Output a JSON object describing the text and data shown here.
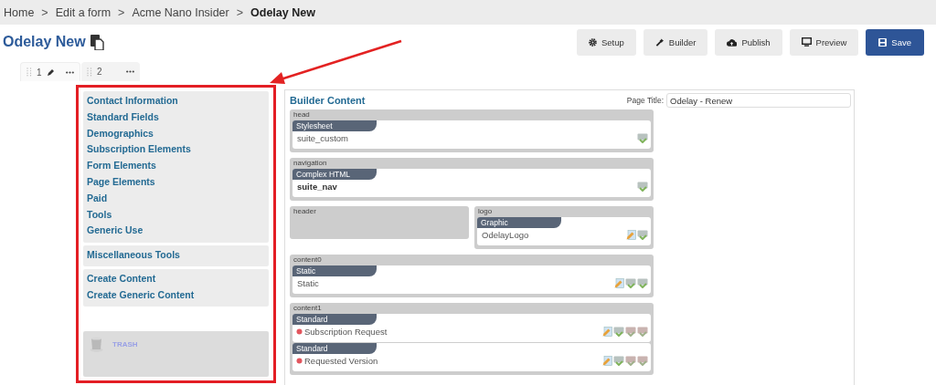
{
  "breadcrumb": [
    {
      "label": "Home",
      "separator": ">",
      "current": false
    },
    {
      "label": "Edit a form",
      "separator": ">",
      "current": false
    },
    {
      "label": "Acme Nano Insider",
      "separator": ">",
      "current": false
    },
    {
      "label": "Odelay New",
      "current": true
    }
  ],
  "page_title": "Odelay New",
  "toolbar": [
    {
      "label": "Setup",
      "kind": "setup",
      "primary": false
    },
    {
      "label": "Builder",
      "kind": "builder",
      "primary": false
    },
    {
      "label": "Publish",
      "kind": "publish",
      "primary": false
    },
    {
      "label": "Preview",
      "kind": "preview",
      "primary": false
    },
    {
      "label": "Save",
      "kind": "save",
      "primary": true
    }
  ],
  "tabs": [
    {
      "label": "1",
      "selected": true,
      "editable": true
    },
    {
      "label": "2",
      "selected": false,
      "editable": false
    }
  ],
  "sidebar": {
    "groups": [
      {
        "items": [
          "Contact Information",
          "Standard Fields",
          "Demographics",
          "Subscription Elements",
          "Form Elements",
          "Page Elements",
          "Paid",
          "Tools",
          "Generic Use"
        ]
      },
      {
        "items": [
          "Miscellaneous Tools"
        ]
      },
      {
        "items": [
          "Create Content",
          "Create Generic Content"
        ]
      }
    ],
    "trash": "TRASH"
  },
  "builder": {
    "title": "Builder Content",
    "page_title_label": "Page Title:",
    "page_title_value": "Odelay - Renew",
    "rows": [
      {
        "sections": [
          {
            "name": "head",
            "modules": [
              {
                "type": "Stylesheet",
                "name": "suite_custom",
                "emphasized": false,
                "required": false,
                "actions": [
                  {
                    "kind": "check"
                  }
                ]
              }
            ]
          }
        ]
      },
      {
        "sections": [
          {
            "name": "navigation",
            "modules": [
              {
                "type": "Complex HTML",
                "name": "suite_nav",
                "emphasized": true,
                "required": false,
                "actions": [
                  {
                    "kind": "check"
                  }
                ]
              }
            ]
          }
        ]
      },
      {
        "sections": [
          {
            "name": "header"
          },
          {
            "name": "logo",
            "modules": [
              {
                "type": "Graphic",
                "name": "OdelayLogo",
                "emphasized": false,
                "required": false,
                "actions": [
                  {
                    "kind": "edit"
                  },
                  {
                    "kind": "check"
                  }
                ]
              }
            ]
          }
        ]
      },
      {
        "sections": [
          {
            "name": "content0",
            "modules": [
              {
                "type": "Static",
                "name": "Static",
                "emphasized": false,
                "required": false,
                "actions": [
                  {
                    "kind": "edit"
                  },
                  {
                    "kind": "check"
                  },
                  {
                    "kind": "check"
                  }
                ]
              }
            ]
          }
        ]
      },
      {
        "sections": [
          {
            "name": "content1",
            "modules": [
              {
                "type": "Standard",
                "name": "Subscription Request",
                "emphasized": false,
                "required": true,
                "actions": [
                  {
                    "kind": "edit"
                  },
                  {
                    "kind": "check"
                  },
                  {
                    "kind": "deny"
                  },
                  {
                    "kind": "deny"
                  }
                ]
              },
              {
                "type": "Standard",
                "name": "Requested Version",
                "emphasized": false,
                "required": true,
                "actions": [
                  {
                    "kind": "edit"
                  },
                  {
                    "kind": "check"
                  },
                  {
                    "kind": "deny"
                  },
                  {
                    "kind": "deny"
                  }
                ]
              }
            ]
          }
        ]
      }
    ]
  }
}
